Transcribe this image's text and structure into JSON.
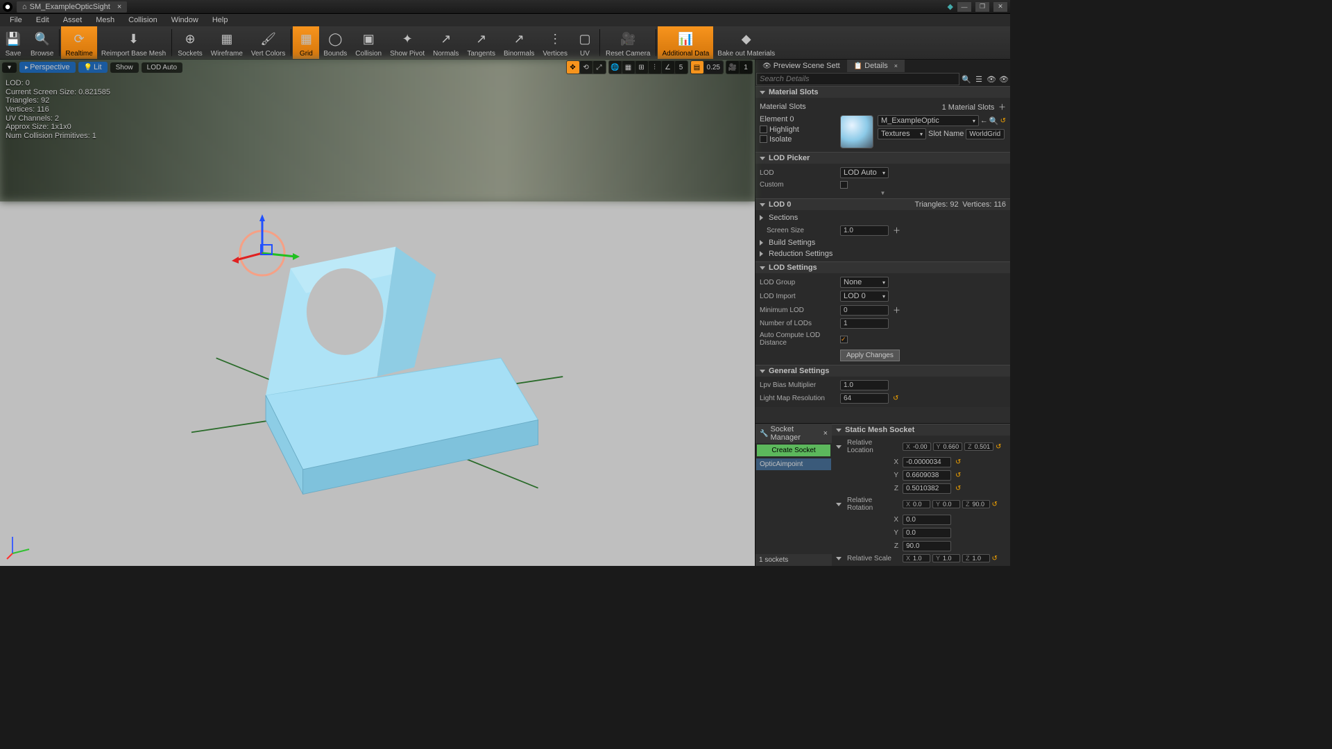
{
  "title_tab": "SM_ExampleOpticSight",
  "menus": [
    "File",
    "Edit",
    "Asset",
    "Mesh",
    "Collision",
    "Window",
    "Help"
  ],
  "toolbar": [
    {
      "label": "Save",
      "icon": "💾"
    },
    {
      "label": "Browse",
      "icon": "🔍"
    },
    {
      "label": "Realtime",
      "icon": "⟳",
      "active": true
    },
    {
      "label": "Reimport Base Mesh",
      "icon": "⬇"
    },
    {
      "label": "Sockets",
      "icon": "⊕"
    },
    {
      "label": "Wireframe",
      "icon": "▦"
    },
    {
      "label": "Vert Colors",
      "icon": "🖌"
    },
    {
      "label": "Grid",
      "icon": "▦",
      "active": true
    },
    {
      "label": "Bounds",
      "icon": "◯"
    },
    {
      "label": "Collision",
      "icon": "▣"
    },
    {
      "label": "Show Pivot",
      "icon": "✦"
    },
    {
      "label": "Normals",
      "icon": "↗"
    },
    {
      "label": "Tangents",
      "icon": "↗"
    },
    {
      "label": "Binormals",
      "icon": "↗"
    },
    {
      "label": "Vertices",
      "icon": "⋮"
    },
    {
      "label": "UV",
      "icon": "▢"
    },
    {
      "label": "Reset Camera",
      "icon": "🎥"
    },
    {
      "label": "Additional Data",
      "icon": "📊",
      "active": true
    },
    {
      "label": "Bake out Materials",
      "icon": "◆"
    }
  ],
  "viewport_controls": {
    "perspective": "Perspective",
    "lit": "Lit",
    "show": "Show",
    "lod": "LOD Auto",
    "grid_snap": "0.25",
    "angle_snap": "5",
    "cam_speed": "1"
  },
  "stats": {
    "lod": "LOD:  0",
    "screen": "Current Screen Size:  0.821585",
    "tris": "Triangles:  92",
    "verts": "Vertices:  116",
    "uv": "UV Channels:  2",
    "approx": "Approx Size: 1x1x0",
    "coll": "Num Collision Primitives:  1"
  },
  "panel_tabs": {
    "preview": "Preview Scene Sett",
    "details": "Details"
  },
  "search_placeholder": "Search Details",
  "matslots": {
    "header": "Material Slots",
    "count_label": "Material Slots",
    "count_val": "1 Material Slots",
    "element": "Element 0",
    "highlight": "Highlight",
    "isolate": "Isolate",
    "mat_name": "M_ExampleOptic",
    "textures_btn": "Textures",
    "slotname_lbl": "Slot Name",
    "slotname_val": "WorldGrid"
  },
  "lodpicker": {
    "header": "LOD Picker",
    "lod_lbl": "LOD",
    "lod_val": "LOD Auto",
    "custom_lbl": "Custom"
  },
  "lod0": {
    "header": "LOD 0",
    "tris": "Triangles: 92",
    "verts": "Vertices: 116",
    "sections": "Sections",
    "screen": "Screen Size",
    "screen_val": "1.0",
    "build": "Build Settings",
    "reduction": "Reduction Settings"
  },
  "lodsettings": {
    "header": "LOD Settings",
    "group_lbl": "LOD Group",
    "group_val": "None",
    "import_lbl": "LOD Import",
    "import_val": "LOD 0",
    "min_lbl": "Minimum LOD",
    "min_val": "0",
    "num_lbl": "Number of LODs",
    "num_val": "1",
    "auto_lbl": "Auto Compute LOD Distance",
    "apply": "Apply Changes"
  },
  "general": {
    "header": "General Settings",
    "lpv_lbl": "Lpv Bias Multiplier",
    "lpv_val": "1.0",
    "lm_lbl": "Light Map Resolution",
    "lm_val": "64"
  },
  "socketmgr": {
    "tab": "Socket Manager",
    "create": "Create Socket",
    "item": "OpticAimpoint",
    "footer": "1 sockets"
  },
  "staticsock": {
    "header": "Static Mesh Socket",
    "rel_loc": "Relative Location",
    "loc": {
      "x": "-0.00",
      "y": "0.660",
      "z": "0.501"
    },
    "x_full": "-0.0000034",
    "y_full": "0.6609038",
    "z_full": "0.5010382",
    "rel_rot": "Relative Rotation",
    "rot": {
      "x": "0.0",
      "y": "0.0",
      "z": "90.0"
    },
    "rx": "0.0",
    "ry": "0.0",
    "rz": "90.0",
    "rel_scale": "Relative Scale",
    "scale": {
      "x": "1.0",
      "y": "1.0",
      "z": "1.0"
    }
  }
}
